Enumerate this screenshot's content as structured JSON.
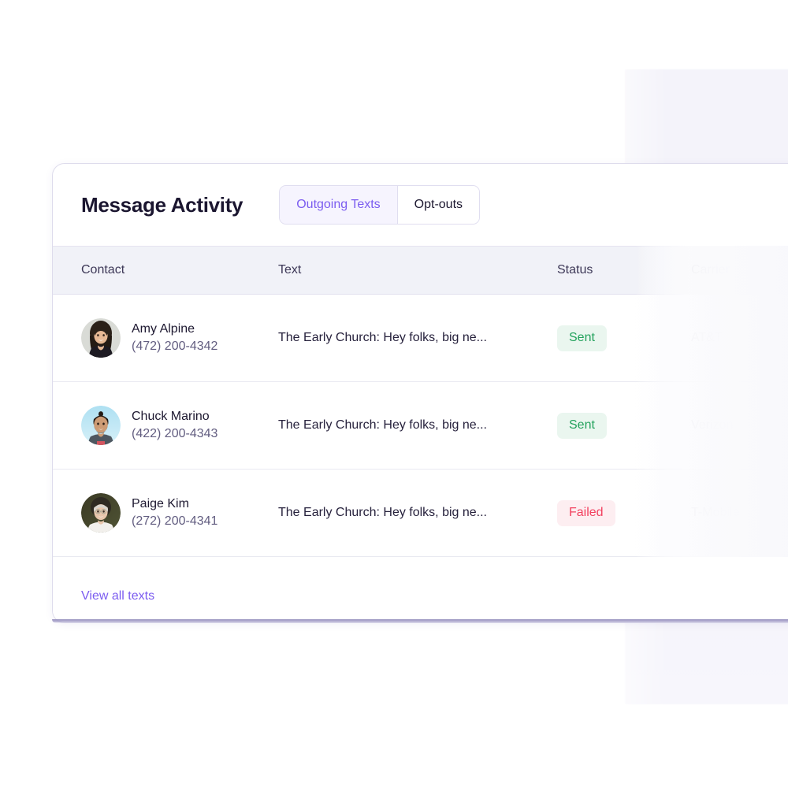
{
  "card": {
    "title": "Message Activity",
    "toggle": {
      "options": [
        {
          "label": "Outgoing Texts",
          "active": true
        },
        {
          "label": "Opt-outs",
          "active": false
        }
      ]
    },
    "columns": [
      "Contact",
      "Text",
      "Status",
      "Carrier"
    ],
    "rows": [
      {
        "name": "Amy Alpine",
        "phone": "(472) 200-4342",
        "text": "The Early Church: Hey folks, big ne...",
        "status": "Sent",
        "status_kind": "sent",
        "carrier": "AT&T",
        "avatar": "avatar-amy-alpine"
      },
      {
        "name": "Chuck Marino",
        "phone": "(422) 200-4343",
        "text": "The Early Church: Hey folks, big ne...",
        "status": "Sent",
        "status_kind": "sent",
        "carrier": "Verizon",
        "avatar": "avatar-chuck-marino"
      },
      {
        "name": "Paige Kim",
        "phone": "(272) 200-4341",
        "text": "The Early Church: Hey folks, big ne...",
        "status": "Failed",
        "status_kind": "failed",
        "carrier": "T-Mobile",
        "avatar": "avatar-paige-kim"
      }
    ],
    "footer": {
      "view_all_label": "View all texts"
    }
  },
  "colors": {
    "accent_purple": "#7b5cf0",
    "status_sent_text": "#23a25c",
    "status_sent_bg": "#eaf6ef",
    "status_failed_text": "#f2415f",
    "status_failed_bg": "#fdeef1",
    "header_bg": "#f1f2f8",
    "title_text": "#1b1630",
    "muted_text": "#8e8aa4"
  }
}
